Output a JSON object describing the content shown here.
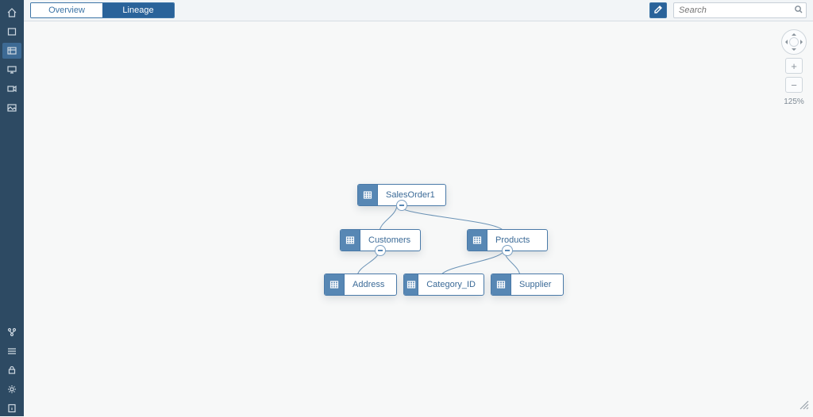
{
  "rail": {
    "top_items": [
      {
        "name": "home-icon"
      },
      {
        "name": "dataset-icon"
      },
      {
        "name": "cube-icon",
        "active": true
      },
      {
        "name": "monitor-icon"
      },
      {
        "name": "video-icon"
      },
      {
        "name": "image-icon"
      }
    ],
    "bottom_items": [
      {
        "name": "flow-icon"
      },
      {
        "name": "stack-icon"
      },
      {
        "name": "lock-icon"
      },
      {
        "name": "gear-icon"
      },
      {
        "name": "info-icon"
      }
    ]
  },
  "tabs": {
    "overview_label": "Overview",
    "lineage_label": "Lineage",
    "active": "lineage"
  },
  "search": {
    "placeholder": "Search"
  },
  "zoom": {
    "level_label": "125%"
  },
  "nodes": {
    "salesorder": {
      "label": "SalesOrder1"
    },
    "customers": {
      "label": "Customers"
    },
    "products": {
      "label": "Products"
    },
    "address": {
      "label": "Address"
    },
    "category": {
      "label": "Category_ID"
    },
    "supplier": {
      "label": "Supplier"
    }
  },
  "icons": {
    "config_button": "edit-config-icon"
  },
  "colors": {
    "rail_bg": "#2d4a63",
    "accent": "#2a639a",
    "node_header": "#5787b4",
    "node_border": "#4a7aa8",
    "edge": "#6b93b6"
  },
  "lineage_tree": {
    "root": "SalesOrder1",
    "children": [
      {
        "name": "Customers",
        "children": [
          {
            "name": "Address"
          }
        ]
      },
      {
        "name": "Products",
        "children": [
          {
            "name": "Category_ID"
          },
          {
            "name": "Supplier"
          }
        ]
      }
    ]
  }
}
